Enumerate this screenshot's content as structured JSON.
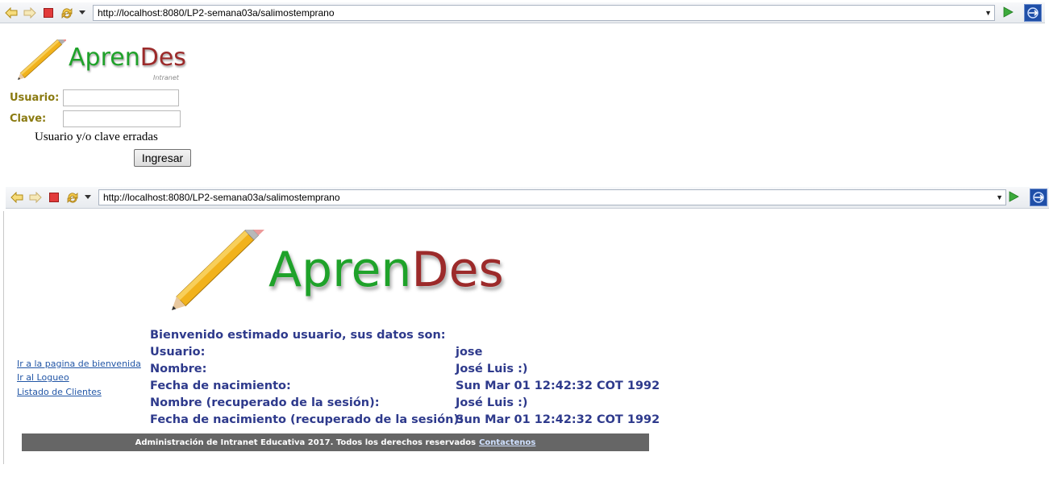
{
  "browser_top": {
    "url": "http://localhost:8080/LP2-semana03a/salimostemprano"
  },
  "login_page": {
    "logo": {
      "part1": "Apren",
      "part2": "Des",
      "sub": "Intranet"
    },
    "usuario_label": "Usuario:",
    "clave_label": "Clave:",
    "usuario_value": "",
    "clave_value": "",
    "error_message": "Usuario y/o clave erradas",
    "submit_label": "Ingresar"
  },
  "browser_bottom": {
    "url": "http://localhost:8080/LP2-semana03a/salimostemprano"
  },
  "welcome_page": {
    "logo": {
      "part1": "Apren",
      "part2": "Des"
    },
    "sidebar_links": [
      "Ir a la pagina de bienvenida",
      "Ir al Logueo",
      "Listado de Clientes"
    ],
    "heading": "Bienvenido estimado usuario, sus datos son:",
    "rows": [
      {
        "label": "Usuario:",
        "value": "jose"
      },
      {
        "label": "Nombre:",
        "value": "José Luis :)"
      },
      {
        "label": "Fecha de nacimiento:",
        "value": "Sun Mar 01 12:42:32 COT 1992"
      },
      {
        "label": "Nombre (recuperado de la sesión):",
        "value": "José Luis :)"
      },
      {
        "label": "Fecha de nacimiento (recuperado de la sesión):",
        "value": "Sun Mar 01 12:42:32 COT 1992"
      }
    ],
    "footer_text": "Administración de Intranet Educativa 2017. Todos los derechos reservados",
    "footer_link": "Contactenos"
  }
}
